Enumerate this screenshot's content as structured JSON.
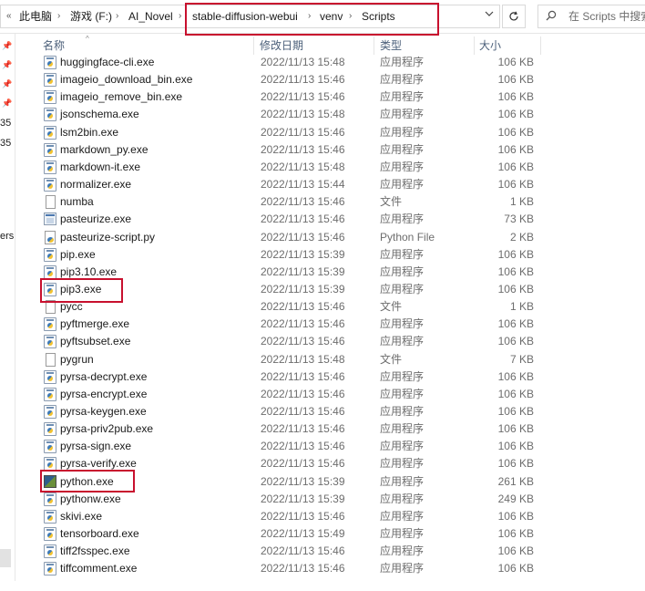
{
  "address_bar": {
    "crumbs": [
      "此电脑",
      "游戏 (F:)",
      "AI_Novel",
      "stable-diffusion-webui",
      "venv",
      "Scripts"
    ],
    "separator": "›",
    "overflow_arrow": "«",
    "dropdown_icon": "chevron-down-icon",
    "refresh_icon": "refresh-icon"
  },
  "search": {
    "placeholder": "在 Scripts 中搜索",
    "icon": "search-icon"
  },
  "nav_fragments": [
    "35",
    "35",
    "ers"
  ],
  "columns": {
    "name": "名称",
    "date": "修改日期",
    "type": "类型",
    "size": "大小"
  },
  "files": [
    {
      "name": "huggingface-cli.exe",
      "date": "2022/11/13 15:48",
      "type": "应用程序",
      "size": "106 KB",
      "icon": "exe-icon"
    },
    {
      "name": "imageio_download_bin.exe",
      "date": "2022/11/13 15:46",
      "type": "应用程序",
      "size": "106 KB",
      "icon": "exe-icon"
    },
    {
      "name": "imageio_remove_bin.exe",
      "date": "2022/11/13 15:46",
      "type": "应用程序",
      "size": "106 KB",
      "icon": "exe-icon"
    },
    {
      "name": "jsonschema.exe",
      "date": "2022/11/13 15:48",
      "type": "应用程序",
      "size": "106 KB",
      "icon": "exe-icon"
    },
    {
      "name": "lsm2bin.exe",
      "date": "2022/11/13 15:46",
      "type": "应用程序",
      "size": "106 KB",
      "icon": "exe-icon"
    },
    {
      "name": "markdown_py.exe",
      "date": "2022/11/13 15:46",
      "type": "应用程序",
      "size": "106 KB",
      "icon": "exe-icon"
    },
    {
      "name": "markdown-it.exe",
      "date": "2022/11/13 15:48",
      "type": "应用程序",
      "size": "106 KB",
      "icon": "exe-icon"
    },
    {
      "name": "normalizer.exe",
      "date": "2022/11/13 15:44",
      "type": "应用程序",
      "size": "106 KB",
      "icon": "exe-icon"
    },
    {
      "name": "numba",
      "date": "2022/11/13 15:46",
      "type": "文件",
      "size": "1 KB",
      "icon": "file-icon"
    },
    {
      "name": "pasteurize.exe",
      "date": "2022/11/13 15:46",
      "type": "应用程序",
      "size": "73 KB",
      "icon": "app-icon"
    },
    {
      "name": "pasteurize-script.py",
      "date": "2022/11/13 15:46",
      "type": "Python File",
      "size": "2 KB",
      "icon": "python-file-icon"
    },
    {
      "name": "pip.exe",
      "date": "2022/11/13 15:39",
      "type": "应用程序",
      "size": "106 KB",
      "icon": "exe-icon"
    },
    {
      "name": "pip3.10.exe",
      "date": "2022/11/13 15:39",
      "type": "应用程序",
      "size": "106 KB",
      "icon": "exe-icon"
    },
    {
      "name": "pip3.exe",
      "date": "2022/11/13 15:39",
      "type": "应用程序",
      "size": "106 KB",
      "icon": "exe-icon"
    },
    {
      "name": "pycc",
      "date": "2022/11/13 15:46",
      "type": "文件",
      "size": "1 KB",
      "icon": "file-icon"
    },
    {
      "name": "pyftmerge.exe",
      "date": "2022/11/13 15:46",
      "type": "应用程序",
      "size": "106 KB",
      "icon": "exe-icon"
    },
    {
      "name": "pyftsubset.exe",
      "date": "2022/11/13 15:46",
      "type": "应用程序",
      "size": "106 KB",
      "icon": "exe-icon"
    },
    {
      "name": "pygrun",
      "date": "2022/11/13 15:48",
      "type": "文件",
      "size": "7 KB",
      "icon": "file-icon"
    },
    {
      "name": "pyrsa-decrypt.exe",
      "date": "2022/11/13 15:46",
      "type": "应用程序",
      "size": "106 KB",
      "icon": "exe-icon"
    },
    {
      "name": "pyrsa-encrypt.exe",
      "date": "2022/11/13 15:46",
      "type": "应用程序",
      "size": "106 KB",
      "icon": "exe-icon"
    },
    {
      "name": "pyrsa-keygen.exe",
      "date": "2022/11/13 15:46",
      "type": "应用程序",
      "size": "106 KB",
      "icon": "exe-icon"
    },
    {
      "name": "pyrsa-priv2pub.exe",
      "date": "2022/11/13 15:46",
      "type": "应用程序",
      "size": "106 KB",
      "icon": "exe-icon"
    },
    {
      "name": "pyrsa-sign.exe",
      "date": "2022/11/13 15:46",
      "type": "应用程序",
      "size": "106 KB",
      "icon": "exe-icon"
    },
    {
      "name": "pyrsa-verify.exe",
      "date": "2022/11/13 15:46",
      "type": "应用程序",
      "size": "106 KB",
      "icon": "exe-icon"
    },
    {
      "name": "python.exe",
      "date": "2022/11/13 15:39",
      "type": "应用程序",
      "size": "261 KB",
      "icon": "python-exe-icon"
    },
    {
      "name": "pythonw.exe",
      "date": "2022/11/13 15:39",
      "type": "应用程序",
      "size": "249 KB",
      "icon": "exe-icon"
    },
    {
      "name": "skivi.exe",
      "date": "2022/11/13 15:46",
      "type": "应用程序",
      "size": "106 KB",
      "icon": "exe-icon"
    },
    {
      "name": "tensorboard.exe",
      "date": "2022/11/13 15:49",
      "type": "应用程序",
      "size": "106 KB",
      "icon": "exe-icon"
    },
    {
      "name": "tiff2fsspec.exe",
      "date": "2022/11/13 15:46",
      "type": "应用程序",
      "size": "106 KB",
      "icon": "exe-icon"
    },
    {
      "name": "tiffcomment.exe",
      "date": "2022/11/13 15:46",
      "type": "应用程序",
      "size": "106 KB",
      "icon": "exe-icon"
    }
  ],
  "colors": {
    "highlight_box": "#c8102e",
    "header_text": "#4c607a",
    "secondary_text": "#6d6d6d"
  }
}
